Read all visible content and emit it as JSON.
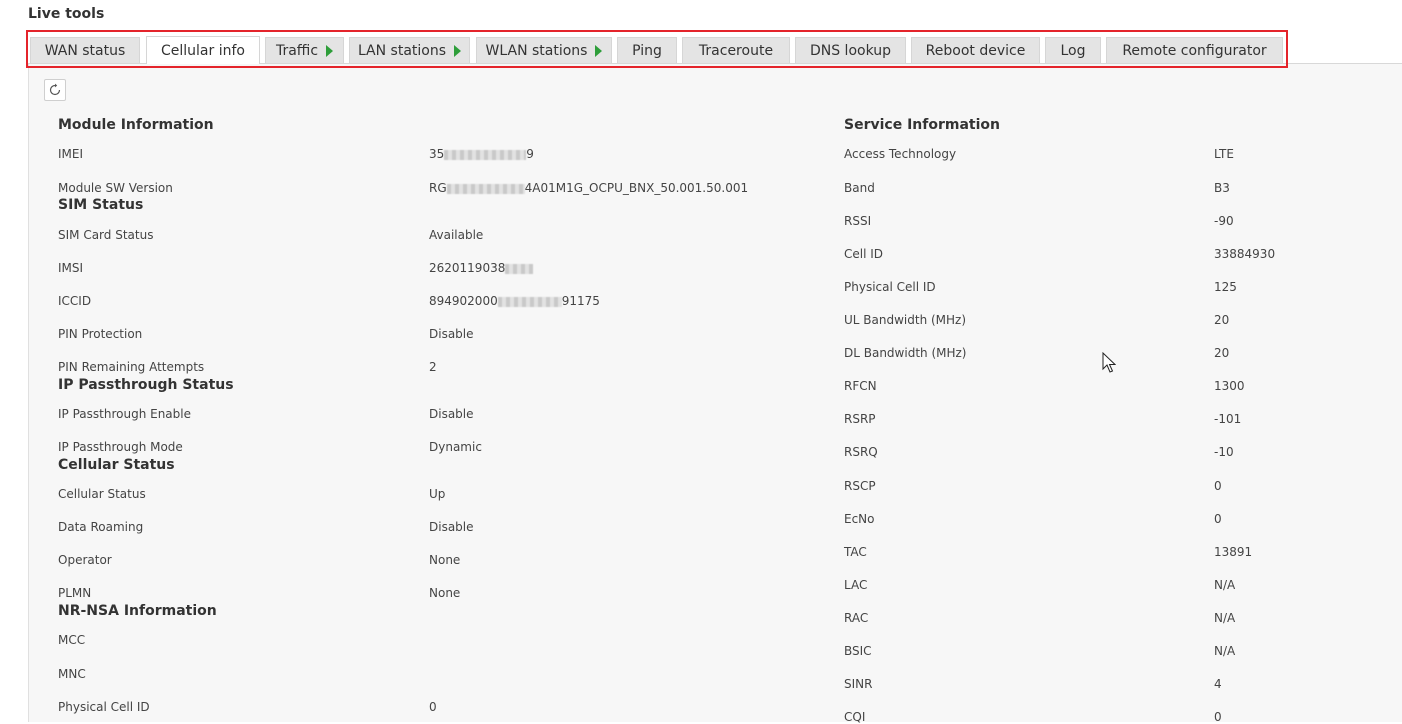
{
  "page": {
    "title": "Live tools"
  },
  "tabs": [
    {
      "label": "WAN status"
    },
    {
      "label": "Cellular info",
      "active": true
    },
    {
      "label": "Traffic",
      "submenu": true
    },
    {
      "label": "LAN stations",
      "submenu": true
    },
    {
      "label": "WLAN stations",
      "submenu": true
    },
    {
      "label": "Ping"
    },
    {
      "label": "Traceroute"
    },
    {
      "label": "DNS lookup"
    },
    {
      "label": "Reboot device"
    },
    {
      "label": "Log"
    },
    {
      "label": "Remote configurator"
    }
  ],
  "colors": {
    "highlight": "#e4242b",
    "submenu_arrow": "#2e9e3a"
  },
  "toolbar": {
    "refresh_icon": "refresh-icon"
  },
  "left": {
    "module": {
      "heading": "Module Information",
      "rows": [
        {
          "label": "IMEI",
          "value_prefix": "35",
          "value_suffix": "9",
          "redacted": true
        },
        {
          "label": "Module SW Version",
          "value_prefix": "RG",
          "value_suffix": "4A01M1G_OCPU_BNX_50.001.50.001",
          "redacted": true
        }
      ]
    },
    "sim": {
      "heading": "SIM Status",
      "rows": [
        {
          "label": "SIM Card Status",
          "value": "Available"
        },
        {
          "label": "IMSI",
          "value_prefix": "2620119038",
          "value_suffix": "",
          "redacted": true
        },
        {
          "label": "ICCID",
          "value_prefix": "894902000",
          "value_suffix": "91175",
          "redacted": true
        },
        {
          "label": "PIN Protection",
          "value": "Disable"
        },
        {
          "label": "PIN Remaining Attempts",
          "value": "2"
        }
      ]
    },
    "ip": {
      "heading": "IP Passthrough Status",
      "rows": [
        {
          "label": "IP Passthrough Enable",
          "value": "Disable"
        },
        {
          "label": "IP Passthrough Mode",
          "value": "Dynamic"
        }
      ]
    },
    "cell": {
      "heading": "Cellular Status",
      "rows": [
        {
          "label": "Cellular Status",
          "value": "Up"
        },
        {
          "label": "Data Roaming",
          "value": "Disable"
        },
        {
          "label": "Operator",
          "value": "None"
        },
        {
          "label": "PLMN",
          "value": "None"
        }
      ]
    },
    "nr": {
      "heading": "NR-NSA Information",
      "rows": [
        {
          "label": "MCC",
          "value": ""
        },
        {
          "label": "MNC",
          "value": ""
        },
        {
          "label": "Physical Cell ID",
          "value": "0"
        }
      ]
    }
  },
  "right": {
    "heading": "Service Information",
    "rows": [
      {
        "label": "Access Technology",
        "value": "LTE"
      },
      {
        "label": "Band",
        "value": "B3"
      },
      {
        "label": "RSSI",
        "value": "-90"
      },
      {
        "label": "Cell ID",
        "value": "33884930"
      },
      {
        "label": "Physical Cell ID",
        "value": "125"
      },
      {
        "label": "UL Bandwidth (MHz)",
        "value": "20"
      },
      {
        "label": "DL Bandwidth (MHz)",
        "value": "20"
      },
      {
        "label": "RFCN",
        "value": "1300"
      },
      {
        "label": "RSRP",
        "value": "-101"
      },
      {
        "label": "RSRQ",
        "value": "-10"
      },
      {
        "label": "RSCP",
        "value": "0"
      },
      {
        "label": "EcNo",
        "value": "0"
      },
      {
        "label": "TAC",
        "value": "13891"
      },
      {
        "label": "LAC",
        "value": "N/A"
      },
      {
        "label": "RAC",
        "value": "N/A"
      },
      {
        "label": "BSIC",
        "value": "N/A"
      },
      {
        "label": "SINR",
        "value": "4"
      },
      {
        "label": "CQI",
        "value": "0"
      }
    ]
  }
}
